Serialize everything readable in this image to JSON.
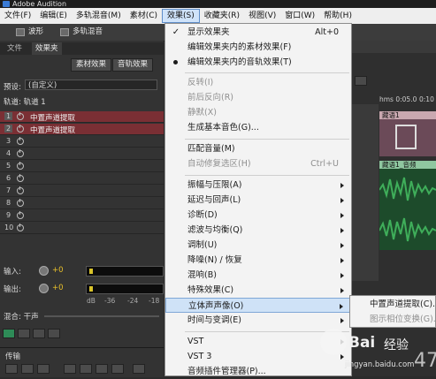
{
  "window": {
    "title": "Adobe Audition"
  },
  "menubar": [
    {
      "label": "文件(F)"
    },
    {
      "label": "编辑(E)"
    },
    {
      "label": "多轨混音(M)"
    },
    {
      "label": "素材(C)"
    },
    {
      "label": "效果(S)"
    },
    {
      "label": "收藏夹(R)"
    },
    {
      "label": "视图(V)"
    },
    {
      "label": "窗口(W)"
    },
    {
      "label": "帮助(H)"
    }
  ],
  "toolbar": {
    "waveform": "波形",
    "multitrack": "多轨混音"
  },
  "left_panel": {
    "tabs": [
      "文件",
      "效果夹"
    ],
    "clip_effects": "素材效果",
    "track_effects": "音轨效果",
    "preset_label": "预设:",
    "preset_value": "(自定义)",
    "track_label": "轨道: 轨道 1",
    "slots": [
      {
        "num": "1",
        "name": "中置声道提取"
      },
      {
        "num": "2",
        "name": "中置声道提取"
      },
      {
        "num": "3",
        "name": ""
      },
      {
        "num": "4",
        "name": ""
      },
      {
        "num": "5",
        "name": ""
      },
      {
        "num": "6",
        "name": ""
      },
      {
        "num": "7",
        "name": ""
      },
      {
        "num": "8",
        "name": ""
      },
      {
        "num": "9",
        "name": ""
      },
      {
        "num": "10",
        "name": ""
      }
    ],
    "input_label": "输入:",
    "output_label": "输出:",
    "gain_in": "+0",
    "gain_out": "+0",
    "scale": [
      "dB",
      "-36",
      "-24",
      "-18"
    ],
    "mix_label": "混合: 干声",
    "transport_label": "传输"
  },
  "menu": {
    "items": [
      {
        "label": "显示效果夹",
        "shortcut": "Alt+0",
        "mark": "check"
      },
      {
        "label": "编辑效果夹内的素材效果(F)"
      },
      {
        "label": "编辑效果夹内的音轨效果(T)",
        "mark": "radio"
      },
      {
        "sep": true
      },
      {
        "label": "反转(I)",
        "disabled": true
      },
      {
        "label": "前后反向(R)",
        "disabled": true
      },
      {
        "label": "静默(X)",
        "disabled": true
      },
      {
        "label": "生成基本音色(G)..."
      },
      {
        "sep": true
      },
      {
        "label": "匹配音量(M)"
      },
      {
        "label": "自动修复选区(H)",
        "shortcut": "Ctrl+U",
        "disabled": true
      },
      {
        "sep": true
      },
      {
        "label": "振幅与压限(A)",
        "submenu": true
      },
      {
        "label": "延迟与回声(L)",
        "submenu": true
      },
      {
        "label": "诊断(D)",
        "submenu": true
      },
      {
        "label": "滤波与均衡(Q)",
        "submenu": true
      },
      {
        "label": "调制(U)",
        "submenu": true
      },
      {
        "label": "降噪(N) / 恢复",
        "submenu": true
      },
      {
        "label": "混响(B)",
        "submenu": true
      },
      {
        "label": "特殊效果(C)",
        "submenu": true
      },
      {
        "label": "立体声声像(O)",
        "submenu": true,
        "highlighted": true
      },
      {
        "label": "时间与变调(E)",
        "submenu": true
      },
      {
        "sep": true
      },
      {
        "label": "VST",
        "submenu": true
      },
      {
        "label": "VST 3",
        "submenu": true
      },
      {
        "label": "音频插件管理器(P)..."
      }
    ]
  },
  "submenu": {
    "items": [
      {
        "label": "中置声道提取(C)..."
      },
      {
        "label": "图示相位变换(G)...",
        "disabled": true
      }
    ]
  },
  "editor": {
    "time_label": "hms 0:05.0",
    "time_label2": "0:10",
    "clip1": "藏语1",
    "clip2": "藏语1_音频",
    "timer": "47"
  },
  "watermark": {
    "brand": "Bai",
    "cn": "经验",
    "url": "jingyan.baidu.com"
  },
  "colors": {
    "fx_slot": "#7a2f34",
    "menu_highlight": "#cfe2f7",
    "wave": "#3fae5a"
  }
}
